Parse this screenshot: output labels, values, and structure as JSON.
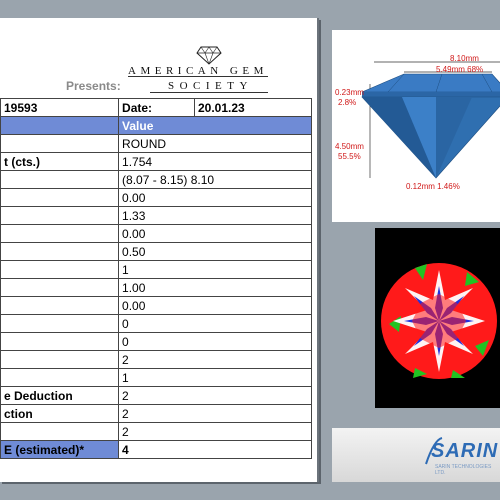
{
  "header": {
    "presents": "Presents:",
    "logo_line1": "AMERICAN GEM",
    "logo_line2": "SOCIETY"
  },
  "report": {
    "id_fragment": "19593",
    "date_label": "Date:",
    "date_value": "20.01.23",
    "value_header": "Value",
    "rows": [
      {
        "label": "",
        "value": "ROUND"
      },
      {
        "label": "t (cts.)",
        "value": "1.754"
      },
      {
        "label": "",
        "value": "(8.07 - 8.15) 8.10"
      },
      {
        "label": "",
        "value": "0.00"
      },
      {
        "label": "",
        "value": "1.33"
      },
      {
        "label": "",
        "value": "0.00"
      },
      {
        "label": "",
        "value": "0.50"
      },
      {
        "label": "",
        "value": "1"
      },
      {
        "label": "",
        "value": "1.00"
      },
      {
        "label": "",
        "value": "0.00"
      },
      {
        "label": "",
        "value": "0"
      },
      {
        "label": "",
        "value": "0"
      },
      {
        "label": "",
        "value": "2"
      },
      {
        "label": "",
        "value": "1"
      },
      {
        "label": "e Deduction",
        "value": "2"
      },
      {
        "label": "ction",
        "value": "2"
      },
      {
        "label": "",
        "value": "2"
      }
    ],
    "final_label": "E (estimated)*",
    "final_value": "4"
  },
  "proportions": {
    "diameter": "8.10mm",
    "table": "5.49mm 68%",
    "crown_height": "0.23mm",
    "crown_pct": "2.8%",
    "pavilion_depth": "4.50mm",
    "pavilion_pct": "55.5%",
    "culet": "0.12mm 1.46%"
  },
  "brand": {
    "name": "SARIN",
    "tagline": "SARIN TECHNOLOGIES LTD."
  },
  "colors": {
    "header_blue": "#6f8bd6",
    "diamond_blue": "#2f6fb0",
    "measure_red": "#d01818",
    "aset_red": "#ff1a1a",
    "aset_green": "#22c322",
    "aset_blue": "#2030e0"
  }
}
